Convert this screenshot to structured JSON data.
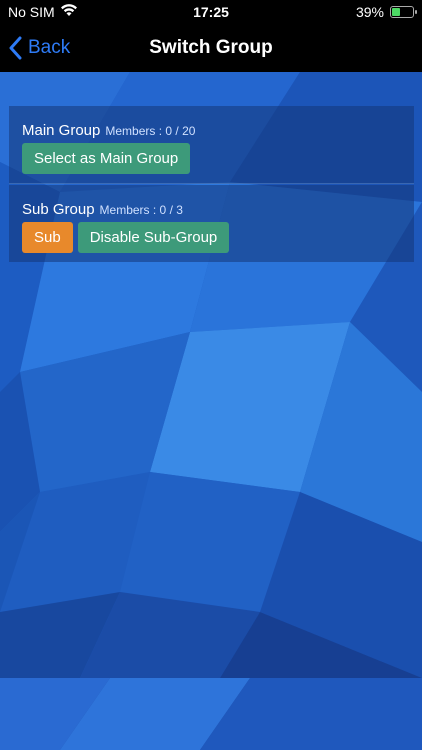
{
  "status": {
    "carrier": "No SIM",
    "time": "17:25",
    "battery_pct": "39%",
    "battery_level": 0.39,
    "icons": [
      "wifi-icon",
      "battery-icon"
    ]
  },
  "nav": {
    "back_label": "Back",
    "title": "Switch Group",
    "back_icon": "chevron-left-icon"
  },
  "main_group": {
    "name": "Main Group",
    "members": "Members : 0 / 20",
    "select_label": "Select as Main Group"
  },
  "sub_group": {
    "name": "Sub Group",
    "members": "Members : 0 / 3",
    "sub_label": "Sub",
    "disable_label": "Disable Sub-Group"
  },
  "colors": {
    "accent": "#2e7bf6",
    "green_button": "#3d9a7a",
    "orange_button": "#e8892b",
    "background": "#1f5fc4"
  }
}
